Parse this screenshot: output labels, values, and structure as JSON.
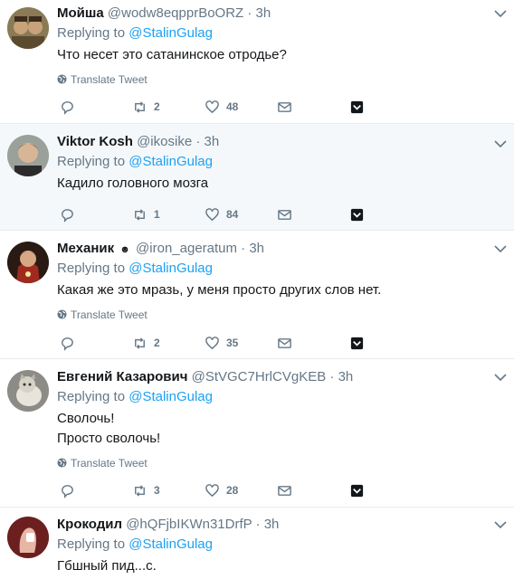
{
  "tweets": [
    {
      "name": "Мойша",
      "handle": "@wodw8eqpprBoORZ",
      "time": "3h",
      "reply_prefix": "Replying to",
      "reply_to": "@StalinGulag",
      "text_lines": [
        "Что несет это сатанинское отродье?"
      ],
      "translate": "Translate Tweet",
      "retweets": "2",
      "likes": "48",
      "highlighted": false
    },
    {
      "name": "Viktor Kosh",
      "handle": "@ikosike",
      "time": "3h",
      "reply_prefix": "Replying to",
      "reply_to": "@StalinGulag",
      "text_lines": [
        "Кадило головного мозга"
      ],
      "translate": "",
      "retweets": "1",
      "likes": "84",
      "highlighted": true
    },
    {
      "name": "Механик",
      "badge": "☻",
      "handle": "@iron_ageratum",
      "time": "3h",
      "reply_prefix": "Replying to",
      "reply_to": "@StalinGulag",
      "text_lines": [
        "Какая же это мразь, у меня просто других слов нет."
      ],
      "translate": "Translate Tweet",
      "retweets": "2",
      "likes": "35",
      "highlighted": false
    },
    {
      "name": "Евгений Казарович",
      "handle": "@StVGC7HrlCVgKEB",
      "time": "3h",
      "reply_prefix": "Replying to",
      "reply_to": "@StalinGulag",
      "text_lines": [
        "Сволочь!",
        "Просто сволочь!"
      ],
      "translate": "Translate Tweet",
      "retweets": "3",
      "likes": "28",
      "highlighted": false
    },
    {
      "name": "Крокодил",
      "handle": "@hQFjbIKWn31DrfP",
      "time": "3h",
      "reply_prefix": "Replying to",
      "reply_to": "@StalinGulag",
      "text_lines": [
        "Гбшный пид...с."
      ],
      "translate": "",
      "retweets": "",
      "likes": "",
      "highlighted": false
    }
  ],
  "colors": {
    "link": "#1da1f2",
    "secondary": "#657786",
    "divider": "#e6ecf0",
    "highlight_bg": "#f5f8fa"
  },
  "icons": [
    "reply-icon",
    "retweet-icon",
    "like-icon",
    "dm-icon",
    "save-icon",
    "chevron-down-icon",
    "globe-icon"
  ]
}
